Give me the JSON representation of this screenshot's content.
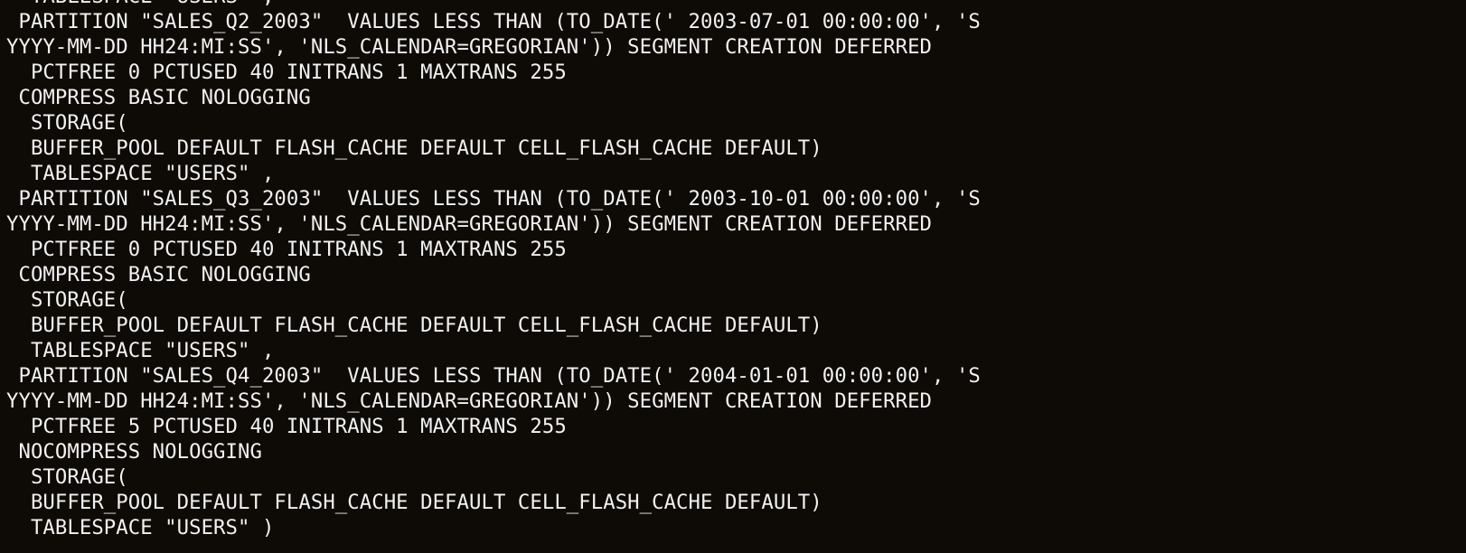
{
  "terminal": {
    "background_color": "#0e0a05",
    "foreground_color": "#f2f2f2",
    "lines": [
      "  TABLESPACE \"USERS\" ,",
      " PARTITION \"SALES_Q2_2003\"  VALUES LESS THAN (TO_DATE(' 2003-07-01 00:00:00', 'S",
      "YYYY-MM-DD HH24:MI:SS', 'NLS_CALENDAR=GREGORIAN')) SEGMENT CREATION DEFERRED",
      "  PCTFREE 0 PCTUSED 40 INITRANS 1 MAXTRANS 255",
      " COMPRESS BASIC NOLOGGING",
      "  STORAGE(",
      "  BUFFER_POOL DEFAULT FLASH_CACHE DEFAULT CELL_FLASH_CACHE DEFAULT)",
      "  TABLESPACE \"USERS\" ,",
      " PARTITION \"SALES_Q3_2003\"  VALUES LESS THAN (TO_DATE(' 2003-10-01 00:00:00', 'S",
      "YYYY-MM-DD HH24:MI:SS', 'NLS_CALENDAR=GREGORIAN')) SEGMENT CREATION DEFERRED",
      "  PCTFREE 0 PCTUSED 40 INITRANS 1 MAXTRANS 255",
      " COMPRESS BASIC NOLOGGING",
      "  STORAGE(",
      "  BUFFER_POOL DEFAULT FLASH_CACHE DEFAULT CELL_FLASH_CACHE DEFAULT)",
      "  TABLESPACE \"USERS\" ,",
      " PARTITION \"SALES_Q4_2003\"  VALUES LESS THAN (TO_DATE(' 2004-01-01 00:00:00', 'S",
      "YYYY-MM-DD HH24:MI:SS', 'NLS_CALENDAR=GREGORIAN')) SEGMENT CREATION DEFERRED",
      "  PCTFREE 5 PCTUSED 40 INITRANS 1 MAXTRANS 255",
      " NOCOMPRESS NOLOGGING",
      "  STORAGE(",
      "  BUFFER_POOL DEFAULT FLASH_CACHE DEFAULT CELL_FLASH_CACHE DEFAULT)",
      "  TABLESPACE \"USERS\" )"
    ]
  }
}
